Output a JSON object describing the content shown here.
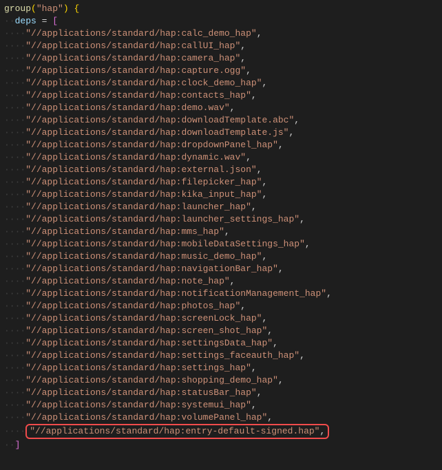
{
  "colors": {
    "background": "#1e1e1e",
    "string": "#ce9178",
    "function": "#dcdcaa",
    "variable": "#9cdcfe",
    "bracket_yellow": "#ffd700",
    "bracket_purple": "#da70d6",
    "bracket_blue": "#179fff",
    "highlight_border": "#f14c4c"
  },
  "header": {
    "fn": "group",
    "open_paren": "(",
    "arg": "\"hap\"",
    "close_paren": ")",
    "space_brace": " {"
  },
  "deps_line": {
    "var": "deps",
    "assign": " = ",
    "open_bracket": "["
  },
  "deps": [
    "\"//applications/standard/hap:calc_demo_hap\"",
    "\"//applications/standard/hap:callUI_hap\"",
    "\"//applications/standard/hap:camera_hap\"",
    "\"//applications/standard/hap:capture.ogg\"",
    "\"//applications/standard/hap:clock_demo_hap\"",
    "\"//applications/standard/hap:contacts_hap\"",
    "\"//applications/standard/hap:demo.wav\"",
    "\"//applications/standard/hap:downloadTemplate.abc\"",
    "\"//applications/standard/hap:downloadTemplate.js\"",
    "\"//applications/standard/hap:dropdownPanel_hap\"",
    "\"//applications/standard/hap:dynamic.wav\"",
    "\"//applications/standard/hap:external.json\"",
    "\"//applications/standard/hap:filepicker_hap\"",
    "\"//applications/standard/hap:kika_input_hap\"",
    "\"//applications/standard/hap:launcher_hap\"",
    "\"//applications/standard/hap:launcher_settings_hap\"",
    "\"//applications/standard/hap:mms_hap\"",
    "\"//applications/standard/hap:mobileDataSettings_hap\"",
    "\"//applications/standard/hap:music_demo_hap\"",
    "\"//applications/standard/hap:navigationBar_hap\"",
    "\"//applications/standard/hap:note_hap\"",
    "\"//applications/standard/hap:notificationManagement_hap\"",
    "\"//applications/standard/hap:photos_hap\"",
    "\"//applications/standard/hap:screenLock_hap\"",
    "\"//applications/standard/hap:screen_shot_hap\"",
    "\"//applications/standard/hap:settingsData_hap\"",
    "\"//applications/standard/hap:settings_faceauth_hap\"",
    "\"//applications/standard/hap:settings_hap\"",
    "\"//applications/standard/hap:shopping_demo_hap\"",
    "\"//applications/standard/hap:statusBar_hap\"",
    "\"//applications/standard/hap:systemui_hap\"",
    "\"//applications/standard/hap:volumePanel_hap\""
  ],
  "highlighted_dep": "\"//applications/standard/hap:entry-default-signed.hap\"",
  "close_bracket": "]",
  "comma": ",",
  "indent_two": "··",
  "indent_four": "····"
}
